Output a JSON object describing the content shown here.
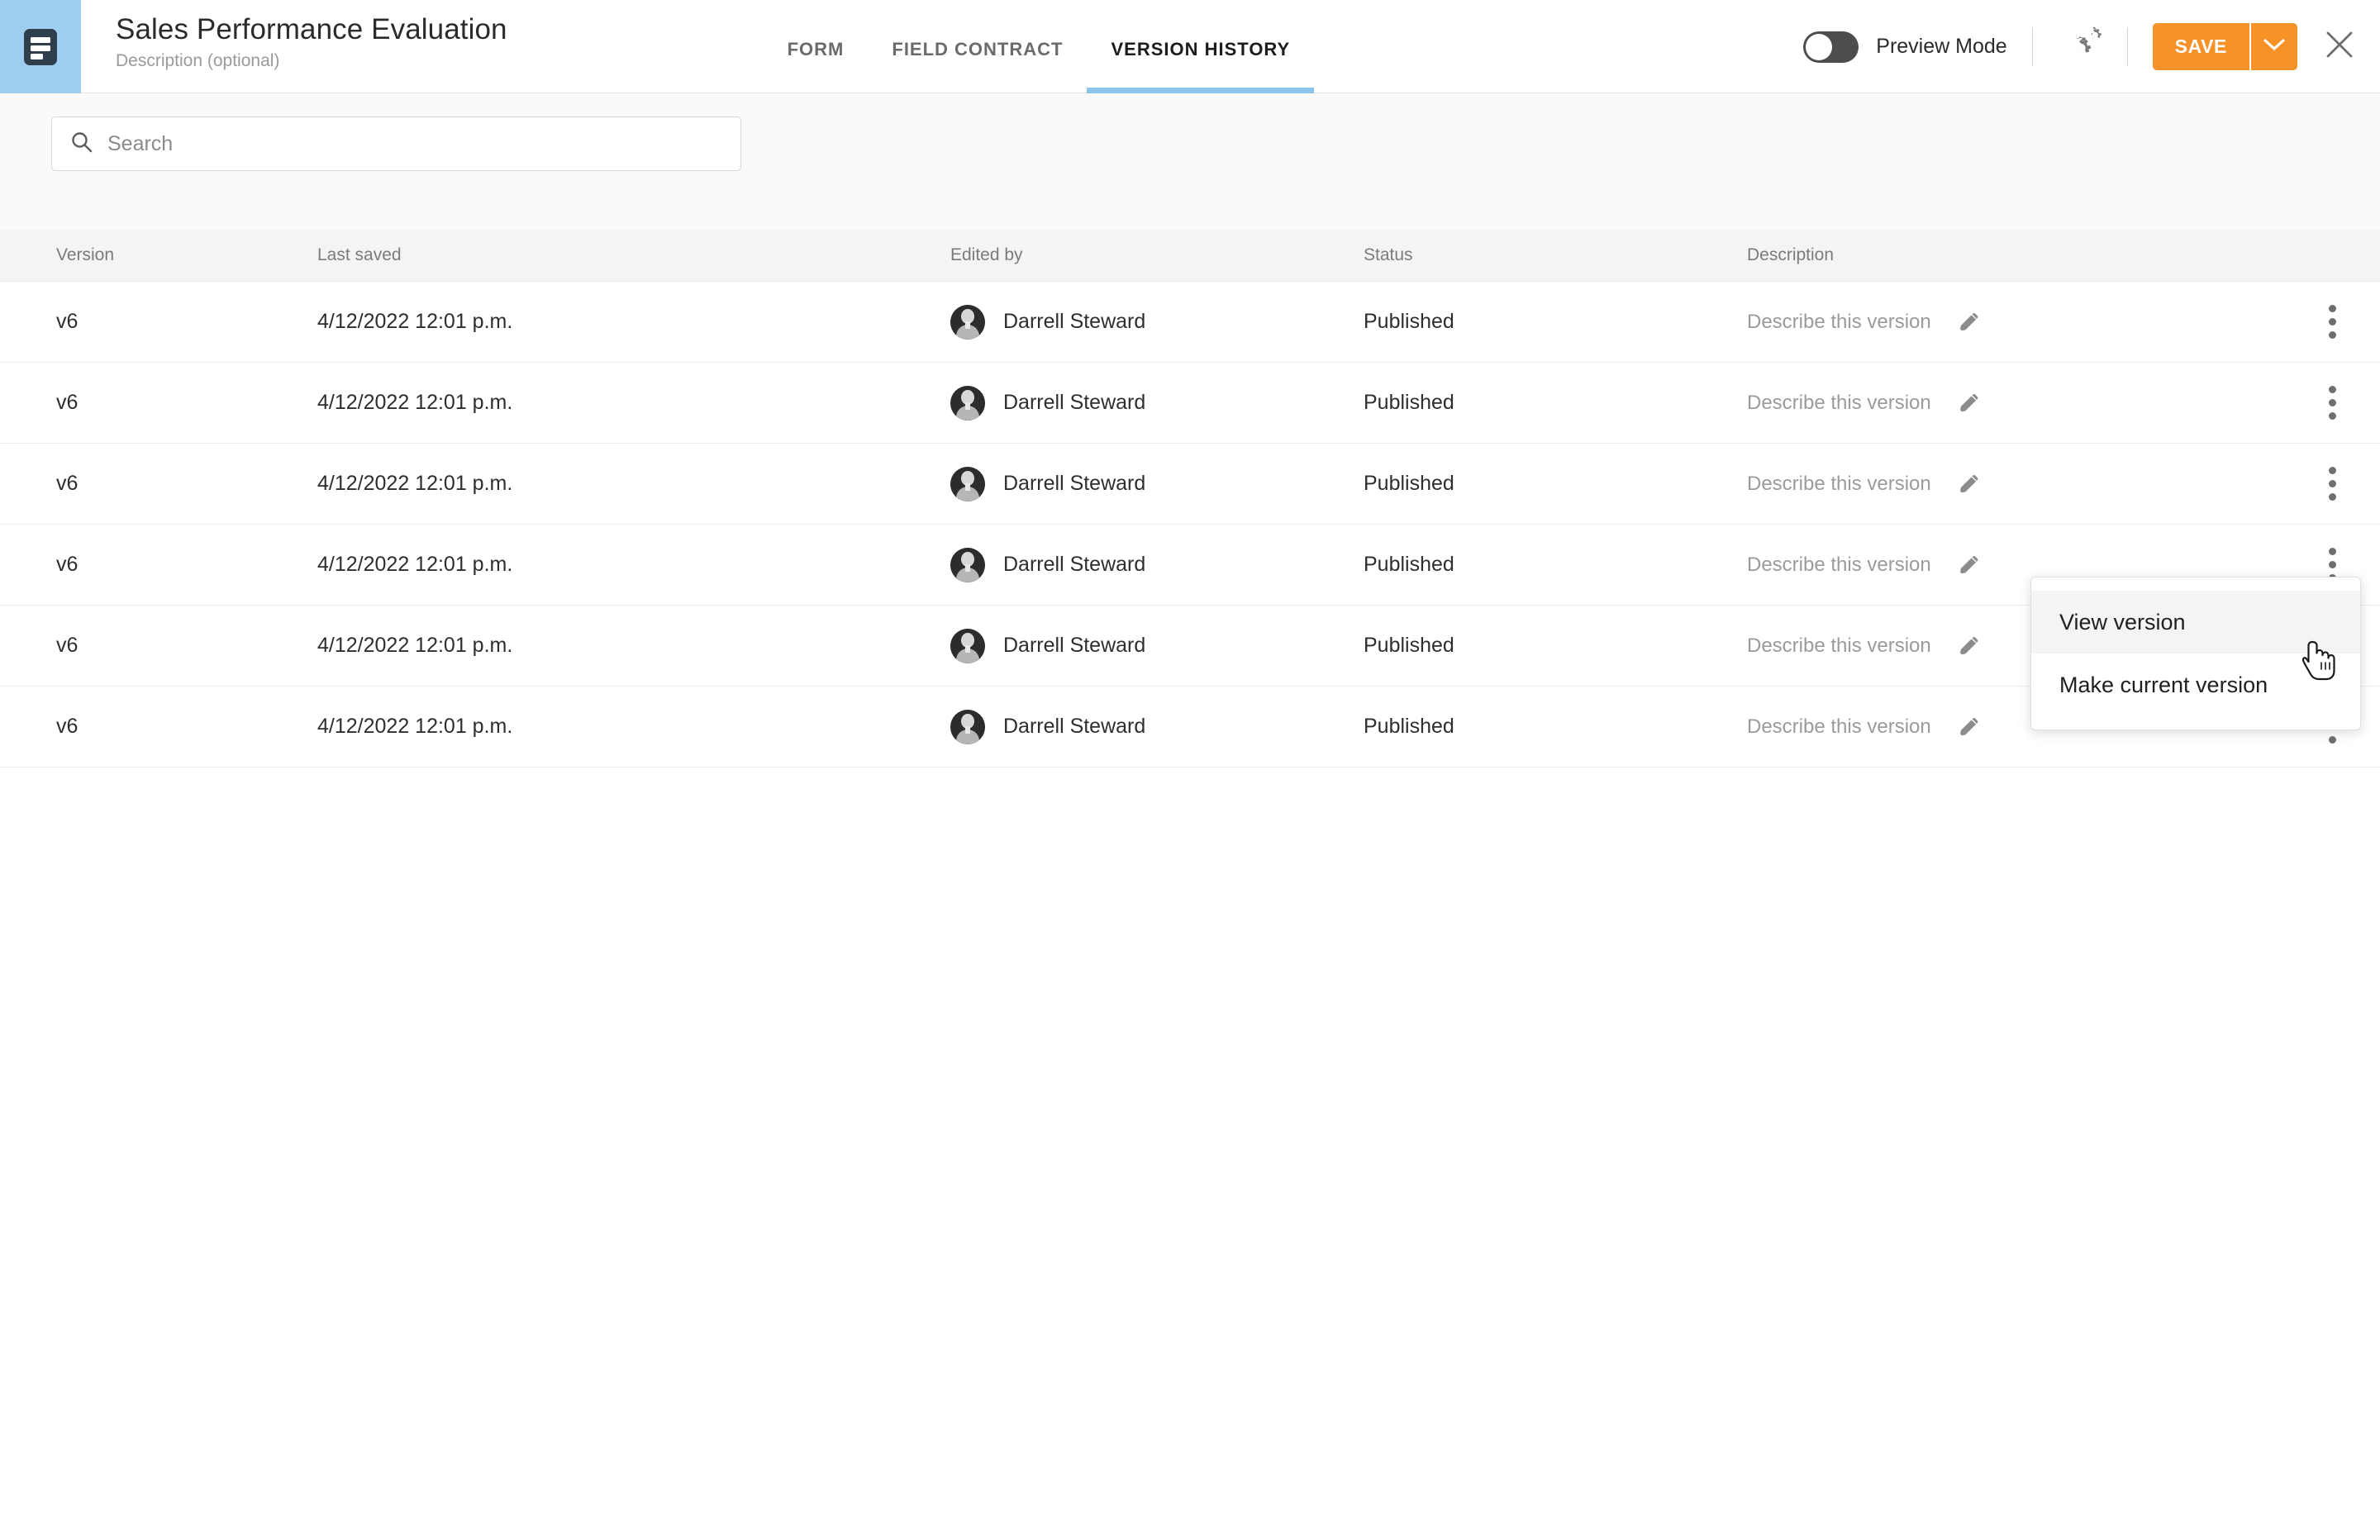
{
  "header": {
    "app_icon": "document-lines-icon",
    "title": "Sales Performance Evaluation",
    "description_placeholder": "Description (optional)",
    "tabs": [
      {
        "label": "FORM",
        "active": false
      },
      {
        "label": "FIELD CONTRACT",
        "active": false
      },
      {
        "label": "VERSION HISTORY",
        "active": true
      }
    ],
    "preview_toggle": {
      "label": "Preview Mode",
      "state": "off"
    },
    "settings_icon": "gears-icon",
    "save_label": "SAVE",
    "save_caret_icon": "chevron-down-icon",
    "close_icon": "close-icon",
    "accent_color": "#f79228",
    "tile_color": "#9ecdf0",
    "active_tab_underline_color": "#8cc5ec"
  },
  "search": {
    "icon": "search-icon",
    "placeholder": "Search",
    "value": ""
  },
  "table": {
    "columns": [
      "Version",
      "Last saved",
      "Edited by",
      "Status",
      "Description"
    ],
    "rows": [
      {
        "version": "v6",
        "last_saved": "4/12/2022 12:01 p.m.",
        "edited_by": "Darrell Steward",
        "status": "Published",
        "description_placeholder": "Describe this version"
      },
      {
        "version": "v6",
        "last_saved": "4/12/2022 12:01 p.m.",
        "edited_by": "Darrell Steward",
        "status": "Published",
        "description_placeholder": "Describe this version"
      },
      {
        "version": "v6",
        "last_saved": "4/12/2022 12:01 p.m.",
        "edited_by": "Darrell Steward",
        "status": "Published",
        "description_placeholder": "Describe this version"
      },
      {
        "version": "v6",
        "last_saved": "4/12/2022 12:01 p.m.",
        "edited_by": "Darrell Steward",
        "status": "Published",
        "description_placeholder": "Describe this version"
      },
      {
        "version": "v6",
        "last_saved": "4/12/2022 12:01 p.m.",
        "edited_by": "Darrell Steward",
        "status": "Published",
        "description_placeholder": "Describe this version"
      },
      {
        "version": "v6",
        "last_saved": "4/12/2022 12:01 p.m.",
        "edited_by": "Darrell Steward",
        "status": "Published",
        "description_placeholder": "Describe this version"
      }
    ],
    "row_edit_icon": "pencil-icon",
    "row_menu_icon": "kebab-menu-icon"
  },
  "context_menu": {
    "open": true,
    "anchor_row_index": 1,
    "items": [
      {
        "label": "View version",
        "hovered": true
      },
      {
        "label": "Make current version",
        "hovered": false
      }
    ]
  },
  "cursor": {
    "type": "pointer-hand"
  }
}
